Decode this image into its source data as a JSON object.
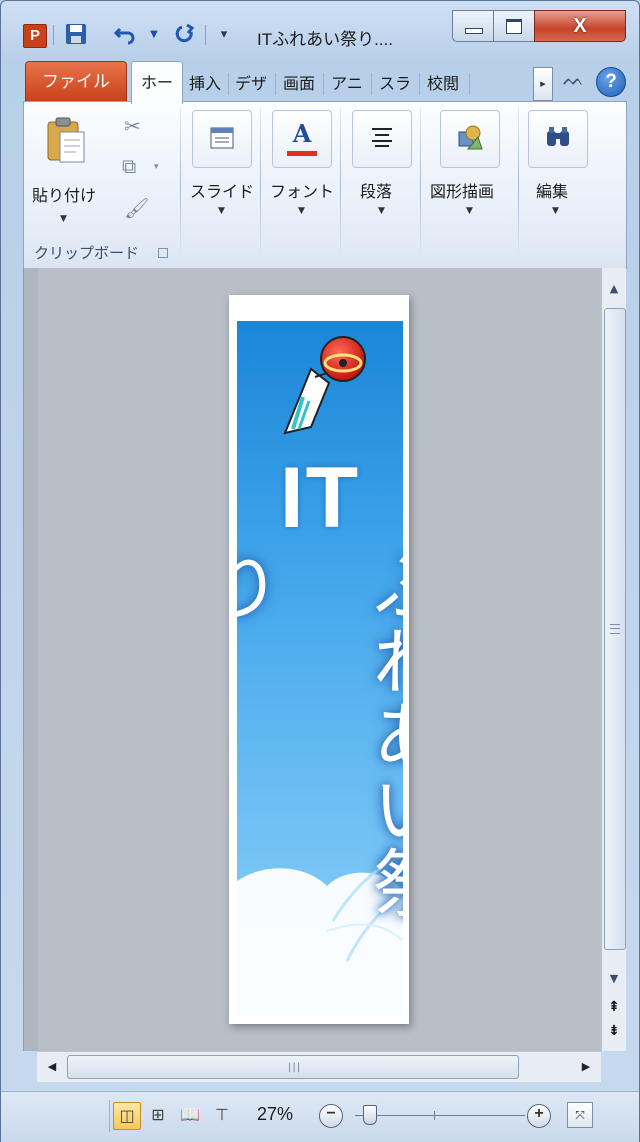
{
  "window": {
    "title": "ITふれあい祭り....",
    "app_icon_letter": "P",
    "quick_access": [
      "save-icon",
      "undo-icon",
      "redo-icon",
      "customize-icon"
    ],
    "controls": {
      "close_glyph": "X"
    }
  },
  "tabs": {
    "file": "ファイル",
    "items": [
      "ホー",
      "挿入",
      "デザ",
      "画面",
      "アニ",
      "スラ",
      "校閲"
    ],
    "active_index": 0
  },
  "ribbon": {
    "paste_label": "貼り付け",
    "clipboard_group": "クリップボード",
    "groups": [
      {
        "label": "スライド",
        "icon": "slide-icon"
      },
      {
        "label": "フォント",
        "icon": "font-icon"
      },
      {
        "label": "段落",
        "icon": "paragraph-icon"
      },
      {
        "label": "図形描画",
        "icon": "shapes-icon"
      },
      {
        "label": "編集",
        "icon": "binoculars-icon"
      }
    ]
  },
  "slide": {
    "title_line1": "IT",
    "title_line2": "ふれあい祭り"
  },
  "statusbar": {
    "zoom": "27%",
    "zoom_fraction": 0.05
  },
  "colors": {
    "file_tab": "#c8411a",
    "slide_top": "#1b86d8",
    "slide_bottom": "#8fd2fb",
    "close_button": "#c8432a"
  }
}
